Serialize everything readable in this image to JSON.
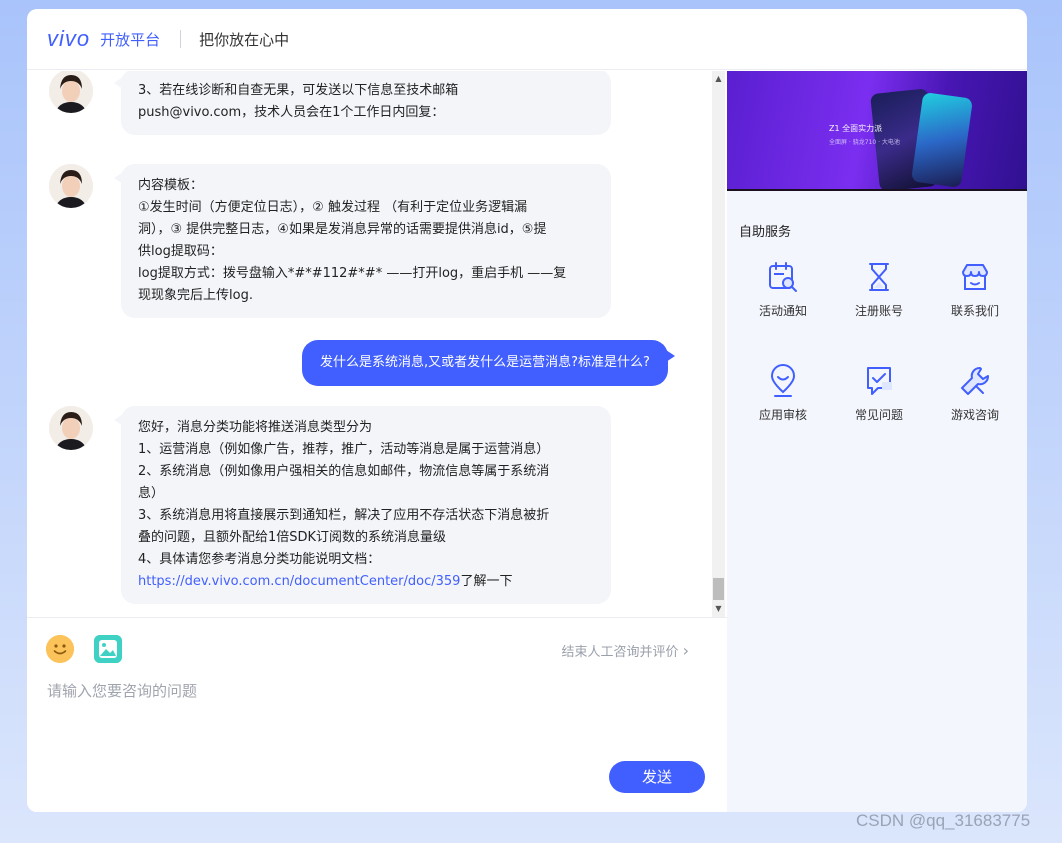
{
  "header": {
    "logo": "vivo",
    "platform": "开放平台",
    "slogan": "把你放在心中"
  },
  "messages": [
    {
      "from": "agent",
      "lines": [
        "3、若在线诊断和自查无果，可发送以下信息至技术邮箱",
        "push@vivo.com，技术人员会在1个工作日内回复："
      ]
    },
    {
      "from": "agent",
      "lines": [
        "内容模板：",
        "①发生时间（方便定位日志），② 触发过程 （有利于定位业务逻辑漏",
        "洞），③ 提供完整日志，④如果是发消息异常的话需要提供消息id，⑤提",
        "供log提取码：",
        "log提取方式：拨号盘输入*#*#112#*#* ——打开log，重启手机 ——复",
        "现现象完后上传log."
      ]
    },
    {
      "from": "user",
      "text": "发什么是系统消息,又或者发什么是运营消息?标准是什么?"
    },
    {
      "from": "agent",
      "lines": [
        "您好，消息分类功能将推送消息类型分为",
        "1、运营消息（例如像广告，推荐，推广，活动等消息是属于运营消息）",
        "2、系统消息（例如像用户强相关的信息如邮件，物流信息等属于系统消",
        "息）",
        "3、系统消息用将直接展示到通知栏，解决了应用不存活状态下消息被折",
        "叠的问题，且额外配给1倍SDK订阅数的系统消息量级",
        "4、具体请您参考消息分类功能说明文档："
      ],
      "link": "https://dev.vivo.com.cn/documentCenter/doc/359",
      "link_suffix": "了解一下"
    }
  ],
  "composer": {
    "end_consult": "结束人工咨询并评价",
    "end_consult_chevron": "›",
    "placeholder": "请输入您要咨询的问题",
    "send_label": "发送"
  },
  "side": {
    "banner_text": "Z1 全面实力派",
    "banner_sub": "全面屏 · 骁龙710 · 大电池",
    "title": "自助服务",
    "services": [
      {
        "label": "活动通知",
        "icon": "calendar-search-icon"
      },
      {
        "label": "注册账号",
        "icon": "hourglass-icon"
      },
      {
        "label": "联系我们",
        "icon": "store-icon"
      },
      {
        "label": "应用审核",
        "icon": "location-pin-icon"
      },
      {
        "label": "常见问题",
        "icon": "chat-check-icon"
      },
      {
        "label": "游戏咨询",
        "icon": "wrench-icon"
      }
    ]
  },
  "colors": {
    "accent": "#415fff",
    "bubble": "#f3f5f9",
    "panel": "#f4f6fe"
  },
  "watermark": "CSDN @qq_31683775"
}
